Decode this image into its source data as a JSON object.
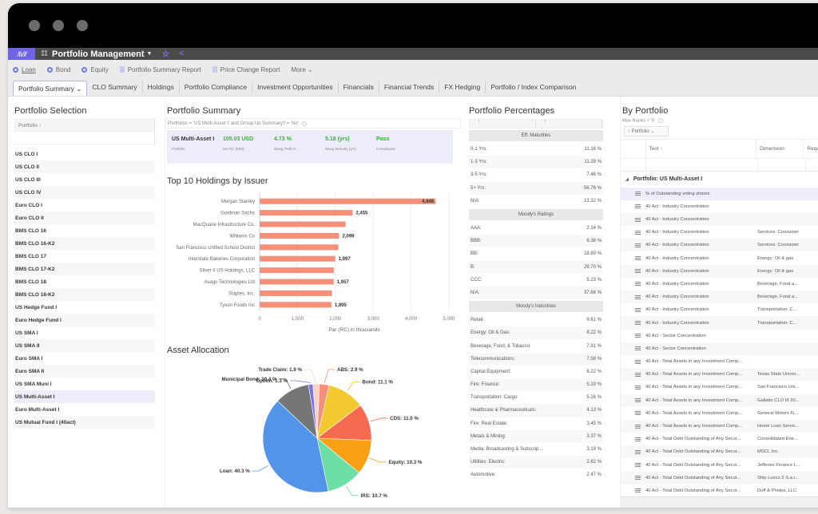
{
  "app": {
    "title": "Portfolio Management",
    "logo_text": "/\\V//",
    "icons": [
      "grid-icon",
      "star-icon",
      "share-icon"
    ]
  },
  "toolbar": {
    "items": [
      {
        "label": "Loan",
        "icon": "add-circle-icon"
      },
      {
        "label": "Bond",
        "icon": "add-circle-icon"
      },
      {
        "label": "Equity",
        "icon": "add-circle-icon"
      },
      {
        "label": "Portfolio Summary Report",
        "icon": "document-icon"
      },
      {
        "label": "Price Change Report",
        "icon": "document-icon"
      },
      {
        "label": "More ⌄",
        "icon": ""
      }
    ]
  },
  "tabs": [
    {
      "label": "Portfolio Summary ⌄",
      "active": true
    },
    {
      "label": "CLO Summary"
    },
    {
      "label": "Holdings"
    },
    {
      "label": "Portfolio Compliance"
    },
    {
      "label": "Investment Opportunities"
    },
    {
      "label": "Financials"
    },
    {
      "label": "Financial Trends"
    },
    {
      "label": "FX Hedging"
    },
    {
      "label": "Portfolio / Index Comparison"
    }
  ],
  "selection": {
    "title": "Portfolio Selection",
    "column": "Portfolio  ↑",
    "selected": "US Multi-Asset I",
    "items": [
      "US CLO I",
      "US CLO II",
      "US CLO III",
      "US CLO IV",
      "Euro CLO I",
      "Euro CLO II",
      "BMS CLO 16",
      "BMS CLO 16-K2",
      "BMS CLO 17",
      "BMS CLO 17-K2",
      "BMS CLO 18",
      "BMS CLO 18-K2",
      "US Hedge Fund I",
      "Euro Hedge Fund I",
      "US SMA I",
      "US SMA II",
      "Euro SMA I",
      "Euro SMA II",
      "US SMA Muni I",
      "US Multi-Asset I",
      "Euro Multi-Asset I",
      "US Mutual Fund I (40act)"
    ]
  },
  "summary": {
    "title": "Portfolio Summary",
    "filter": "Portfolios = 'US Multi-Asset I' and Group Up Summary? = 'No'",
    "kpis": [
      {
        "value": "US Multi-Asset I",
        "label": "Portfolio"
      },
      {
        "value": "105.03 USD",
        "label": "MV RC (MM)"
      },
      {
        "value": "4.73 %",
        "label": "Wavg Yield %"
      },
      {
        "value": "5.18 (yrs)",
        "label": "Wavg Maturity (yrs)"
      },
      {
        "value": "Pass",
        "label": "Compliance"
      }
    ],
    "status_color": "#34b233"
  },
  "chart_data": [
    {
      "type": "bar",
      "orientation": "horizontal",
      "title": "Top 10 Holdings by Issuer",
      "categories": [
        "Morgan Stanley",
        "Goldman Sachs",
        "MacQuarie Infrastructure Co.",
        "Williams Co",
        "San Francisco Unified School District",
        "Interstate Bakeries Corporation",
        "Sliver II US Holdings, LLC",
        "Avago Technologies Ltd",
        "Staples, Inc.",
        "Tyson Foods Inc"
      ],
      "values": [
        4646,
        2455,
        2270,
        2099,
        2080,
        1997,
        1960,
        1957,
        1910,
        1895
      ],
      "data_labels": [
        "4,646",
        "2,455",
        "",
        "2,099",
        "",
        "1,997",
        "",
        "1,957",
        "",
        "1,895"
      ],
      "xlabel": "Par (RC) in thousands",
      "ylabel": "",
      "xlim": [
        0,
        5000
      ],
      "ticks": [
        "0",
        "1,000",
        "2,000",
        "3,000",
        "4,000",
        "5,000"
      ],
      "tick_values": [
        0,
        1000,
        2000,
        3000,
        4000,
        5000
      ],
      "color": "#f4907a",
      "grid": true
    },
    {
      "type": "pie",
      "title": "Asset Allocation",
      "slices": [
        {
          "label": "ABS",
          "value": 2.9,
          "color": "#f4907a"
        },
        {
          "label": "Bond",
          "value": 11.1,
          "color": "#f2c930"
        },
        {
          "label": "CDS",
          "value": 11.0,
          "color": "#f66a50"
        },
        {
          "label": "Equity",
          "value": 10.3,
          "color": "#fb9f14"
        },
        {
          "label": "IRS",
          "value": 10.7,
          "color": "#6ddea6"
        },
        {
          "label": "Loan",
          "value": 40.3,
          "color": "#5295e8"
        },
        {
          "label": "Municipal Bond",
          "value": 10.4,
          "color": "#767676"
        },
        {
          "label": "Option",
          "value": 1.3,
          "color": "#7b72f5"
        },
        {
          "label": "Trade Claim",
          "value": 1.9,
          "color": "#f6d3c5"
        }
      ],
      "label_format": "{label}: {value} %"
    }
  ],
  "percentages": {
    "title": "Portfolio Percentages",
    "col_headers": [
      "↑",
      "↑"
    ],
    "groups": [
      {
        "name": "Eff. Maturities",
        "rows": [
          [
            "0-1 Yrs:",
            "11.16 %"
          ],
          [
            "1-3 Yrs:",
            "11.29 %"
          ],
          [
            "3-5 Yrs:",
            "7.46 %"
          ],
          [
            "5+ Yrs:",
            "56.76 %"
          ],
          [
            "N/A:",
            "13.32 %"
          ]
        ]
      },
      {
        "name": "Moody's Ratings",
        "rows": [
          [
            "AAA:",
            "2.14 %"
          ],
          [
            "BBB:",
            "6.38 %"
          ],
          [
            "BB:",
            "18.89 %"
          ],
          [
            "B:",
            "29.70 %"
          ],
          [
            "CCC:",
            "5.23 %"
          ],
          [
            "N/A:",
            "37.66 %"
          ]
        ]
      },
      {
        "name": "Moody's Industries",
        "rows": [
          [
            "Retail:",
            "9.61 %"
          ],
          [
            "Energy: Oil & Gas:",
            "8.22 %"
          ],
          [
            "Beverage, Food, & Tobacco:",
            "7.91 %"
          ],
          [
            "Telecommunications:",
            "7.58 %"
          ],
          [
            "Capital Equipment:",
            "6.22 %"
          ],
          [
            "Fire: Finance:",
            "5.19 %"
          ],
          [
            "Transportation: Cargo:",
            "5.16 %"
          ],
          [
            "Healthcare & Pharmaceuticals:",
            "4.13 %"
          ],
          [
            "Fire: Real Estate:",
            "3.45 %"
          ],
          [
            "Metals & Mining:",
            "3.37 %"
          ],
          [
            "Media: Broadcasting & Subscrip...",
            "3.19 %"
          ],
          [
            "Utilities: Electric:",
            "2.62 %"
          ],
          [
            "Automotive:",
            "2.47 %"
          ]
        ]
      }
    ]
  },
  "by_portfolio": {
    "title": "By Portfolio",
    "filter": "Max Ranks = '5'",
    "group_button": "↑  Portfolio  ⌄",
    "columns": [
      "Test  ↑",
      "Dimension",
      "Requ"
    ],
    "group_label": "Portfolio: US Multi-Asset I",
    "rows": [
      [
        "% of Outstanding voting shares",
        ""
      ],
      [
        "40 Act - Industry Concentration",
        ""
      ],
      [
        "40 Act - Industry Concentration",
        ""
      ],
      [
        "40 Act - Industry Concentration",
        "Services: Consumer"
      ],
      [
        "40 Act - Industry Concentration",
        "Services: Consumer"
      ],
      [
        "40 Act - Industry Concentration",
        "Energy: Oil & gas"
      ],
      [
        "40 Act - Industry Concentration",
        "Energy: Oil & gas"
      ],
      [
        "40 Act - Industry Concentration",
        "Beverage, Food a..."
      ],
      [
        "40 Act - Industry Concentration",
        "Beverage, Food a..."
      ],
      [
        "40 Act - Industry Concentration",
        "Transportation: C..."
      ],
      [
        "40 Act - Industry Concentration",
        "Transportation: C..."
      ],
      [
        "40 Act - Sector Concentration",
        ""
      ],
      [
        "40 Act - Sector Concentration",
        ""
      ],
      [
        "40 Act - Total Assets in any Investment Comp...",
        ""
      ],
      [
        "40 Act - Total Assets in any Investment Comp...",
        "Texas State Univer..."
      ],
      [
        "40 Act - Total Assets in any Investment Comp...",
        "San Francisco Uni..."
      ],
      [
        "40 Act - Total Assets in any Investment Comp...",
        "Gallatin CLO III 20..."
      ],
      [
        "40 Act - Total Assets in any Investment Comp...",
        "General Motors Fi..."
      ],
      [
        "40 Act - Total Assets in any Investment Comp...",
        "Home Loan Servic..."
      ],
      [
        "40 Act - Total Debt Outstanding of Any Secur...",
        "Consolidated Ene..."
      ],
      [
        "40 Act - Total Debt Outstanding of Any Secur...",
        "MSCI, Inc."
      ],
      [
        "40 Act - Total Debt Outstanding of Any Secur...",
        "Jefferies Finance L..."
      ],
      [
        "40 Act - Total Debt Outstanding of Any Secur...",
        "Ship Luxco 3 S.a.r..."
      ],
      [
        "40 Act - Total Debt Outstanding of Any Secur...",
        "Duff & Phelps, LLC"
      ]
    ]
  }
}
